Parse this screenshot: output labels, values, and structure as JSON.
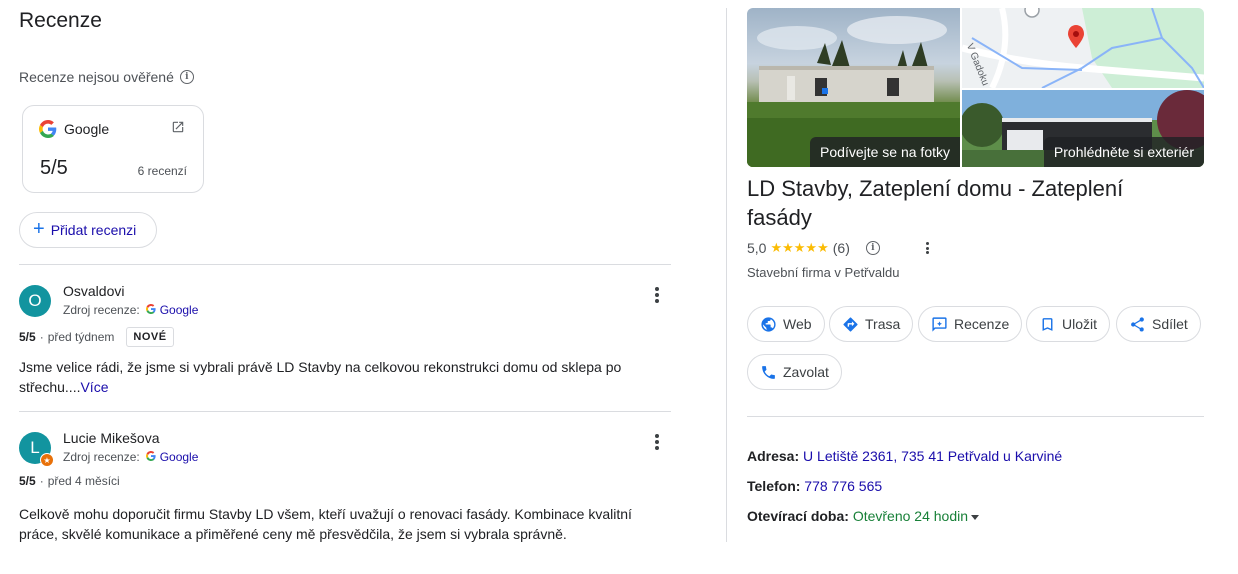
{
  "reviews_panel": {
    "title": "Recenze",
    "unverified_text": "Recenze nejsou ověřené",
    "google_card": {
      "name": "Google",
      "score": "5/5",
      "count": "6 recenzí"
    },
    "add_review_label": "Přidat recenzi",
    "source_label": "Zdroj recenze:",
    "source_name": "Google",
    "reviews": [
      {
        "avatar_letter": "O",
        "author": "Osvaldovi",
        "score": "5/5",
        "separator": "·",
        "time": "před týdnem",
        "badge": "NOVÉ",
        "text": "Jsme velice rádi, že jsme si vybrali právě LD Stavby na celkovou rekonstrukci domu od sklepa po střechu....",
        "more": "Více"
      },
      {
        "avatar_letter": "L",
        "author": "Lucie Mikešova",
        "score": "5/5",
        "separator": "·",
        "time": "před 4 měsíci",
        "text": "Celkově mohu doporučit firmu Stavby LD všem, kteří uvažují o renovaci fasády. Kombinace kvalitní práce, skvělé komunikace a přiměřené ceny mě přesvědčila, že jsem si vybrala správně."
      }
    ]
  },
  "business": {
    "photos": {
      "main_label": "Podívejte se na fotky",
      "map_street": "V Gadoku",
      "exterior_label": "Prohlédněte si exteriér"
    },
    "name": "LD Stavby, Zateplení domu - Zateplení fasády",
    "rating_value": "5,0",
    "stars": "★★★★★",
    "rating_count": "(6)",
    "category": "Stavební firma v Petřvaldu",
    "actions": {
      "web": "Web",
      "route": "Trasa",
      "reviews": "Recenze",
      "save": "Uložit",
      "share": "Sdílet",
      "call": "Zavolat"
    },
    "address_label": "Adresa:",
    "address": "U Letiště 2361, 735 41 Petřvald u Karviné",
    "phone_label": "Telefon:",
    "phone": "778 776 565",
    "hours_label": "Otevírací doba:",
    "hours": "Otevřeno 24 hodin"
  },
  "colors": {
    "link": "#1a0dab",
    "accent_blue": "#1a73e8",
    "open_green": "#188038",
    "star_yellow": "#fbbc04",
    "avatar_teal": "#12949f"
  }
}
